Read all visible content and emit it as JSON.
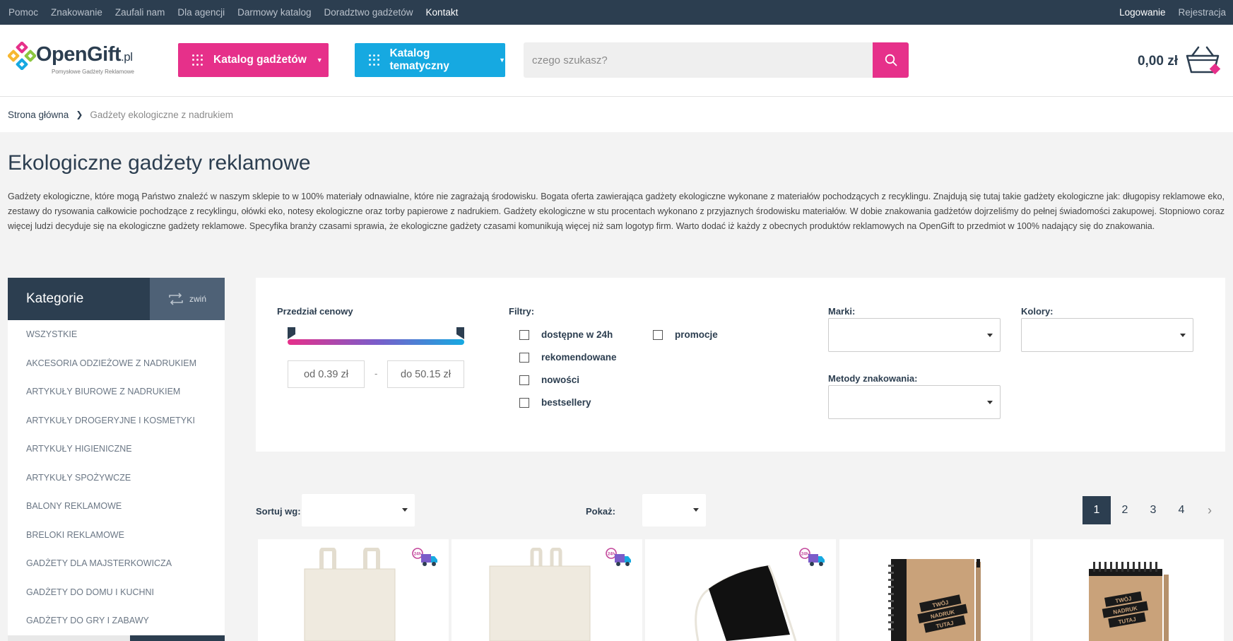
{
  "topbar": {
    "links": [
      "Pomoc",
      "Znakowanie",
      "Zaufali nam",
      "Dla agencji",
      "Darmowy katalog",
      "Doradztwo gadżetów",
      "Kontakt"
    ],
    "login": "Logowanie",
    "register": "Rejestracja"
  },
  "header": {
    "logo_name": "OpenGift",
    "logo_tld": ".pl",
    "logo_tagline": "Pomysłowe Gadżety Reklamowe",
    "catalog_button": "Katalog gadżetów",
    "themes_button": "Katalog tematyczny",
    "search_placeholder": "czego szukasz?",
    "cart_total": "0,00 zł"
  },
  "breadcrumb": {
    "home": "Strona główna",
    "current": "Gadżety ekologiczne z nadrukiem"
  },
  "page": {
    "title": "Ekologiczne gadżety reklamowe",
    "description": "Gadżety ekologiczne, które mogą Państwo znaleźć w naszym sklepie to w 100% materiały odnawialne, które nie zagrażają środowisku. Bogata oferta zawierająca gadżety ekologiczne wykonane z materiałów pochodzących z recyklingu. Znajdują się tutaj takie gadżety ekologiczne jak: długopisy reklamowe eko, zestawy do rysowania całkowicie pochodzące z recyklingu, ołówki eko, notesy ekologiczne oraz torby papierowe z nadrukiem. Gadżety ekologiczne w stu procentach wykonano z przyjaznych środowisku materiałów. W dobie znakowania gadżetów dojrzeliśmy do pełnej świadomości zakupowej. Stopniowo coraz więcej ludzi decyduje się na ekologiczne gadżety reklamowe. Specyfika branży czasami sprawia, że ekologiczne gadżety czasami komunikują więcej niż sam logotyp firm. Warto dodać iż każdy z obecnych produktów reklamowych na OpenGift to przedmiot w 100% nadający się do znakowania."
  },
  "sidebar": {
    "title": "Kategorie",
    "toggle": "zwiń",
    "items": [
      "Wszystkie",
      "Akcesoria odzieżowe z nadrukiem",
      "Artykuły biurowe z nadrukiem",
      "Artykuły drogeryjne i kosmetyki",
      "Artykuły higieniczne",
      "Artykuły spożywcze",
      "Balony reklamowe",
      "Breloki reklamowe",
      "Gadżety dla majsterkowicza",
      "Gadżety do domu i kuchni",
      "Gadżety do gry i zabawy"
    ]
  },
  "filters": {
    "price_label": "Przedział cenowy",
    "price_from": "od 0.39 zł",
    "price_to": "do 50.15 zł",
    "price_sep": "-",
    "filters_label": "Filtry:",
    "options": [
      "dostępne w 24h",
      "rekomendowane",
      "nowości",
      "bestsellery"
    ],
    "promo": "promocje",
    "brands_label": "Marki:",
    "colors_label": "Kolory:",
    "methods_label": "Metody znakowania:"
  },
  "listing": {
    "sort_label": "Sortuj wg:",
    "show_label": "Pokaż:",
    "pages": [
      "1",
      "2",
      "3",
      "4"
    ],
    "current_page": "1",
    "next": "›"
  },
  "products": [
    {
      "badge": "24h",
      "kind": "tote-bag"
    },
    {
      "badge": "24h",
      "kind": "tote-bag"
    },
    {
      "badge": "24h",
      "kind": "drawstring-bag"
    },
    {
      "badge": "",
      "kind": "notebook",
      "print_text": [
        "TWÓJ",
        "NADRUK",
        "TUTAJ"
      ]
    },
    {
      "badge": "",
      "kind": "notepad",
      "print_text": [
        "TWÓJ",
        "NADRUK",
        "TUTAJ"
      ]
    }
  ],
  "colors": {
    "navy": "#2c3e50",
    "pink": "#e6308a",
    "blue": "#16a9e1",
    "purple": "#7b5cc9"
  }
}
